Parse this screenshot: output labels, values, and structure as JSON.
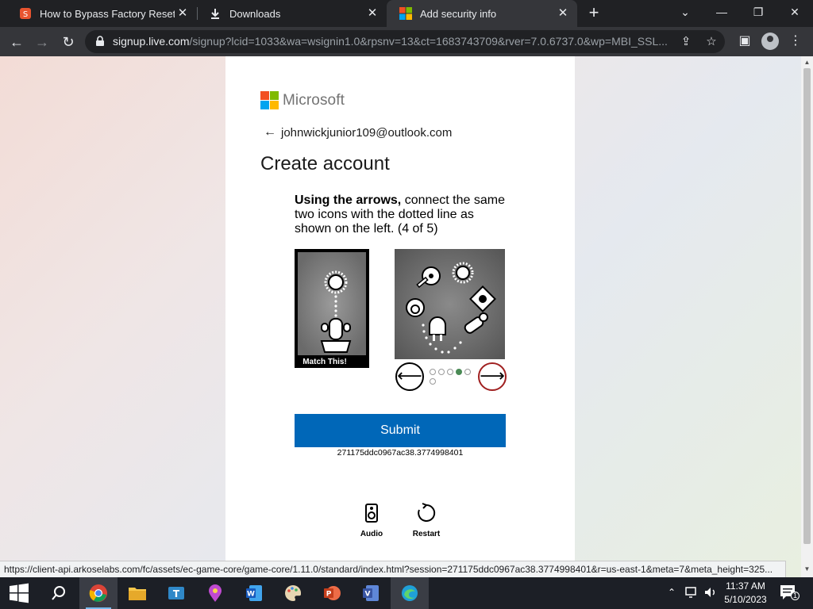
{
  "browser": {
    "tabs": [
      {
        "title": "How to Bypass Factory Reset Pro",
        "active": false
      },
      {
        "title": "Downloads",
        "active": false
      },
      {
        "title": "Add security info",
        "active": true
      }
    ],
    "url_host": "signup.live.com",
    "url_rest": "/signup?lcid=1033&wa=wsignin1.0&rpsnv=13&ct=1683743709&rver=7.0.6737.0&wp=MBI_SSL...",
    "status_url": "https://client-api.arkoselabs.com/fc/assets/ec-game-core/game-core/1.11.0/standard/index.html?session=271175ddc0967ac38.3774998401&r=us-east-1&meta=7&meta_height=325..."
  },
  "page": {
    "brand": "Microsoft",
    "email": "johnwickjunior109@outlook.com",
    "title": "Create account",
    "instruction_bold": "Using the arrows,",
    "instruction_rest": " connect the same two icons with the dotted line as shown on the left. (4 of 5)",
    "match_label": "Match This!",
    "pager": {
      "total": 6,
      "current": 4
    },
    "submit_label": "Submit",
    "session_id": "271175ddc0967ac38.3774998401",
    "audio_label": "Audio",
    "restart_label": "Restart"
  },
  "taskbar": {
    "time": "11:37 AM",
    "date": "5/10/2023",
    "notification_count": "1",
    "apps": [
      "start-icon",
      "search-icon",
      "chrome-icon",
      "file-explorer-icon",
      "teams-icon",
      "maps-icon",
      "word-icon",
      "paint-icon",
      "powerpoint-icon",
      "visio-icon",
      "edge-icon"
    ]
  },
  "colors": {
    "submit_blue": "#0067b8",
    "ms_red": "#f25022",
    "ms_green": "#7fba00",
    "ms_blue": "#00a4ef",
    "ms_yellow": "#ffb900"
  }
}
